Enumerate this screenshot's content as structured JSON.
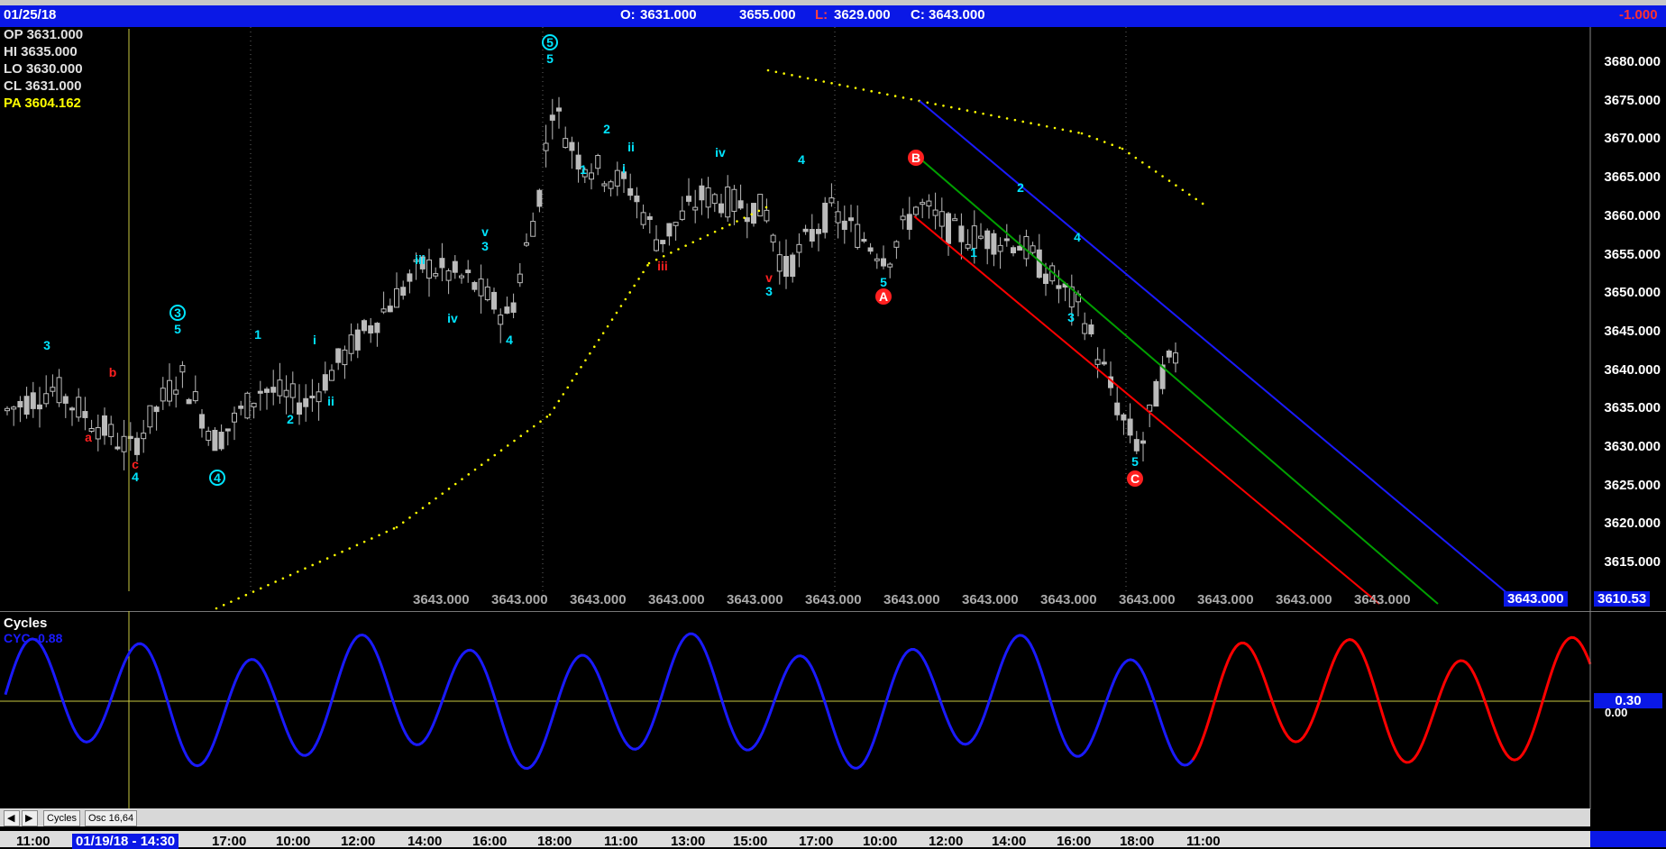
{
  "header": {
    "date": "01/25/18",
    "open_label": "O:",
    "open": "3631.000",
    "high": "3655.000",
    "low_label": "L:",
    "low": "3629.000",
    "close_label": "C:",
    "close": "3643.000",
    "change": "-1.000"
  },
  "ohlc_box": {
    "op": "OP  3631.000",
    "hi": "HI   3635.000",
    "lo": "LO  3630.000",
    "cl": "CL  3631.000",
    "pa": "PA  3604.162"
  },
  "price_axis": [
    "3680.000",
    "3675.000",
    "3670.000",
    "3665.000",
    "3660.000",
    "3655.000",
    "3650.000",
    "3645.000",
    "3640.000",
    "3635.000",
    "3630.000",
    "3625.000",
    "3620.000",
    "3615.000"
  ],
  "price_axis_tags": {
    "last": "3643.000",
    "cursor": "3610.53"
  },
  "bottom_readouts": [
    "3643.000",
    "3643.000",
    "3643.000",
    "3643.000",
    "3643.000",
    "3643.000",
    "3643.000",
    "3643.000",
    "3643.000",
    "3643.000",
    "3643.000",
    "3643.000",
    "3643.000"
  ],
  "oscillator": {
    "title": "Cycles",
    "series_label": "CYC -0.88",
    "value_tag": "0.30",
    "zero_label": "0.00"
  },
  "tabs": [
    "Cycles",
    "Osc 16,64"
  ],
  "time_axis": [
    "11:00",
    "01/19/18 - 14:30",
    "17:00",
    "10:00",
    "12:00",
    "14:00",
    "16:00",
    "18:00",
    "11:00",
    "13:00",
    "15:00",
    "17:00",
    "10:00",
    "12:00",
    "14:00",
    "16:00",
    "18:00",
    "11:00"
  ],
  "wave_labels": [
    "3",
    "b",
    "a",
    "c",
    "4",
    "3",
    "5",
    "4",
    "1",
    "2",
    "i",
    "ii",
    "iii",
    "iv",
    "3",
    "v",
    "4",
    "5",
    "5",
    "1",
    "2",
    "i",
    "ii",
    "iii",
    "iv",
    "4",
    "v",
    "3",
    "5",
    "A",
    "B",
    "1",
    "2",
    "3",
    "4",
    "5",
    "C"
  ],
  "colors": {
    "header_bg": "#0a18e6",
    "wave_label": "#00e5ff",
    "wave_label_red": "#ff2020",
    "channel_top": "#1a1aff",
    "channel_mid": "#00a000",
    "channel_bottom": "#ff0000",
    "dots": "#ffff00",
    "cycle_past": "#1a1aff",
    "cycle_future": "#ff0000"
  }
}
